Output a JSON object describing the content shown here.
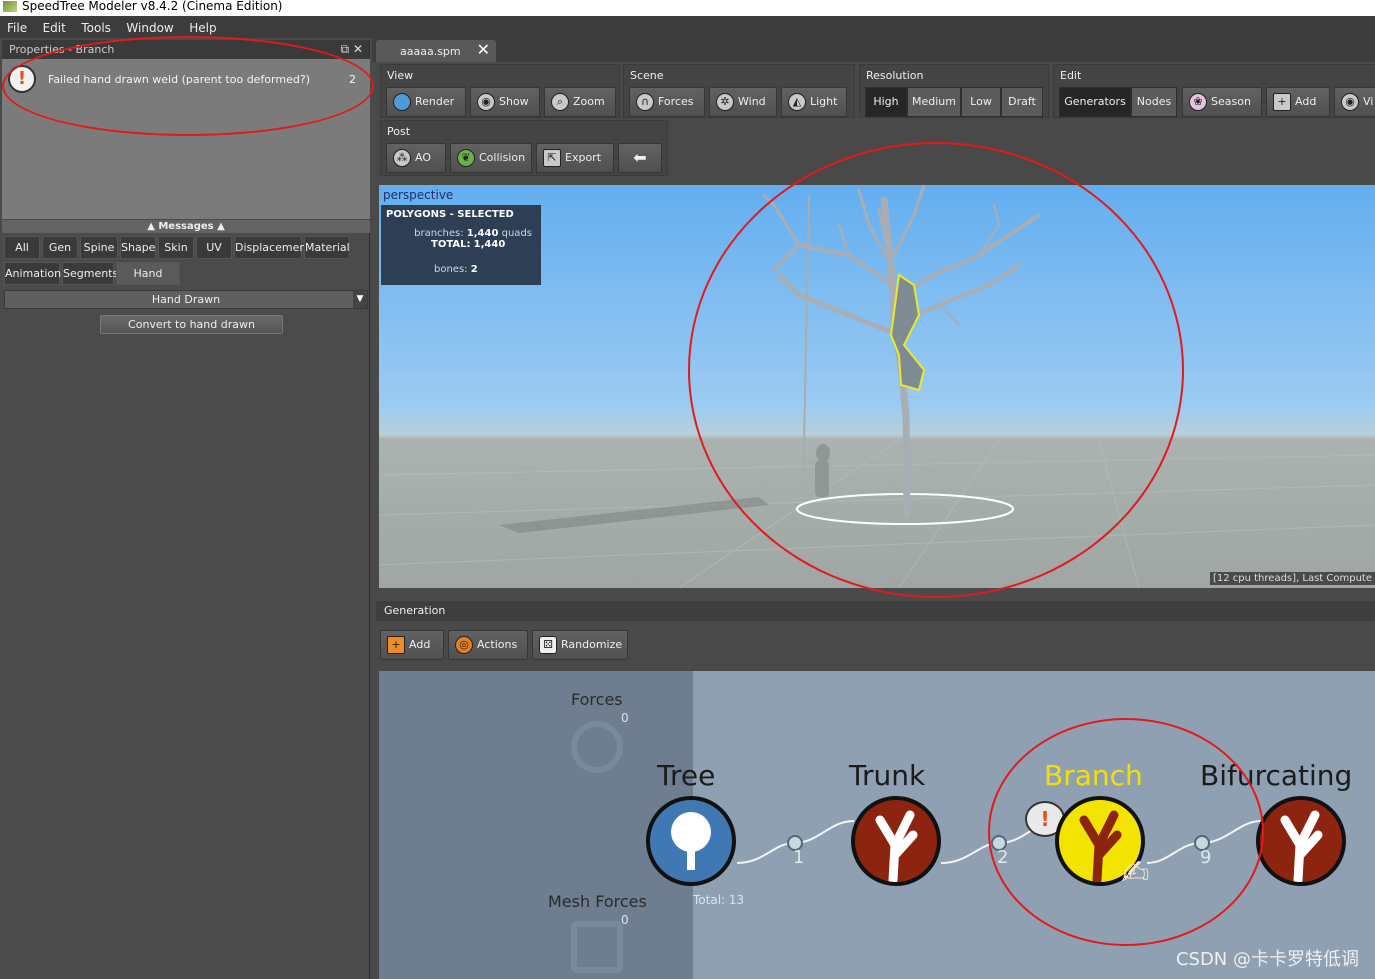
{
  "window": {
    "title": "SpeedTree Modeler v8.4.2 (Cinema Edition)"
  },
  "menu": [
    "File",
    "Edit",
    "Tools",
    "Window",
    "Help"
  ],
  "properties": {
    "header": "Properties - Branch",
    "message": {
      "text": "Failed hand drawn weld (parent too deformed?)",
      "count": "2"
    },
    "messages_label": "Messages",
    "filter_tabs": [
      "All",
      "Gen",
      "Spine",
      "Shape",
      "Skin",
      "UV",
      "Displacement",
      "Material",
      "Animation",
      "Segments",
      "Hand Drawn"
    ],
    "section_select": "Hand Drawn",
    "convert_button": "Convert to hand drawn"
  },
  "document_tab": "aaaaa.spm",
  "toolbar": {
    "view": {
      "label": "View",
      "buttons": [
        "Render",
        "Show",
        "Zoom"
      ]
    },
    "scene": {
      "label": "Scene",
      "buttons": [
        "Forces",
        "Wind",
        "Light"
      ]
    },
    "resolution": {
      "label": "Resolution",
      "options": [
        "High",
        "Medium",
        "Low",
        "Draft"
      ],
      "selected": "High"
    },
    "edit": {
      "label": "Edit",
      "options": [
        "Generators",
        "Nodes"
      ],
      "selected": "Generators",
      "buttons": [
        "Season",
        "Add",
        "Vi"
      ]
    },
    "post": {
      "label": "Post",
      "buttons": [
        "AO",
        "Collision",
        "Export"
      ]
    }
  },
  "viewport": {
    "camera": "perspective",
    "stats_title": "POLYGONS - SELECTED",
    "branches_label": "branches:",
    "branches_value": "1,440",
    "branches_unit": "quads",
    "total_label": "TOTAL:",
    "total_value": "1,440",
    "bones_label": "bones:",
    "bones_value": "2",
    "status": "[12 cpu threads], Last Compute"
  },
  "generation": {
    "header": "Generation",
    "buttons": [
      "Add",
      "Actions",
      "Randomize"
    ],
    "forces": {
      "label": "Forces",
      "count": "0"
    },
    "mesh_forces": {
      "label": "Mesh Forces",
      "count": "0"
    },
    "total": "Total: 13",
    "nodes": [
      {
        "title": "Tree",
        "out": "1"
      },
      {
        "title": "Trunk",
        "out": "2"
      },
      {
        "title": "Branch",
        "out": "9"
      },
      {
        "title": "Bifurcating"
      }
    ],
    "warning_glyph": "!"
  },
  "watermark": "CSDN @卡卡罗特低调",
  "colors": {
    "annotation": "#e3191c",
    "selected_node": "#f2e300",
    "node": "#8c2410"
  }
}
